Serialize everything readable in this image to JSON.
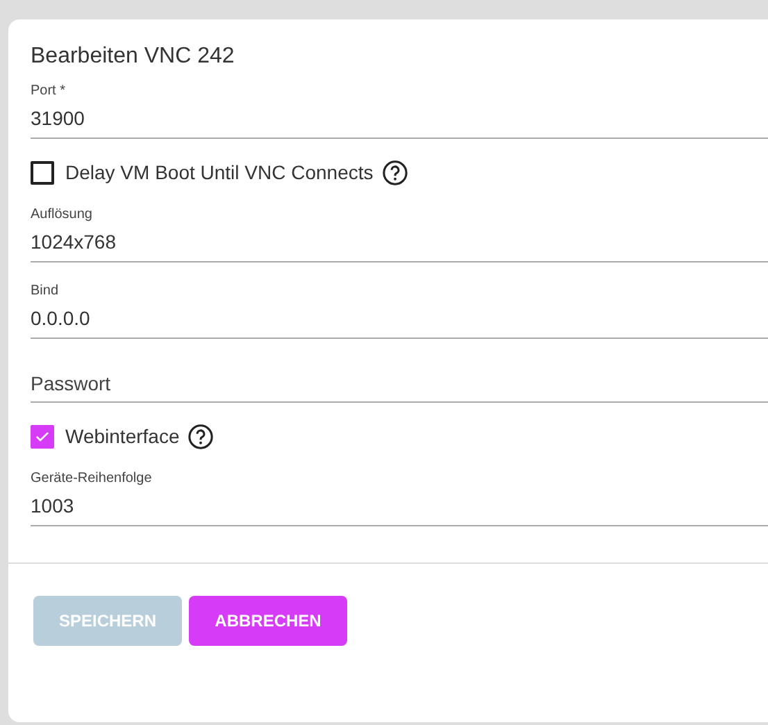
{
  "dialog": {
    "title": "Bearbeiten VNC 242"
  },
  "fields": [
    {
      "kind": "text",
      "label": "Port *",
      "value": "31900"
    },
    {
      "kind": "checkbox",
      "label": "Delay VM Boot Until VNC Connects",
      "checked": false,
      "help": true
    },
    {
      "kind": "text",
      "label": "Auflösung",
      "value": "1024x768"
    },
    {
      "kind": "text",
      "label": "Bind",
      "value": "0.0.0.0"
    },
    {
      "kind": "password",
      "placeholder": "Passwort"
    },
    {
      "kind": "checkbox",
      "label": "Webinterface",
      "checked": true,
      "help": true
    },
    {
      "kind": "text",
      "label": "Geräte-Reihenfolge",
      "value": "1003"
    }
  ],
  "buttons": [
    {
      "label": "SPEICHERN",
      "kind": "primary",
      "disabled": true
    },
    {
      "label": "ABBRECHEN",
      "kind": "secondary",
      "disabled": false
    }
  ]
}
